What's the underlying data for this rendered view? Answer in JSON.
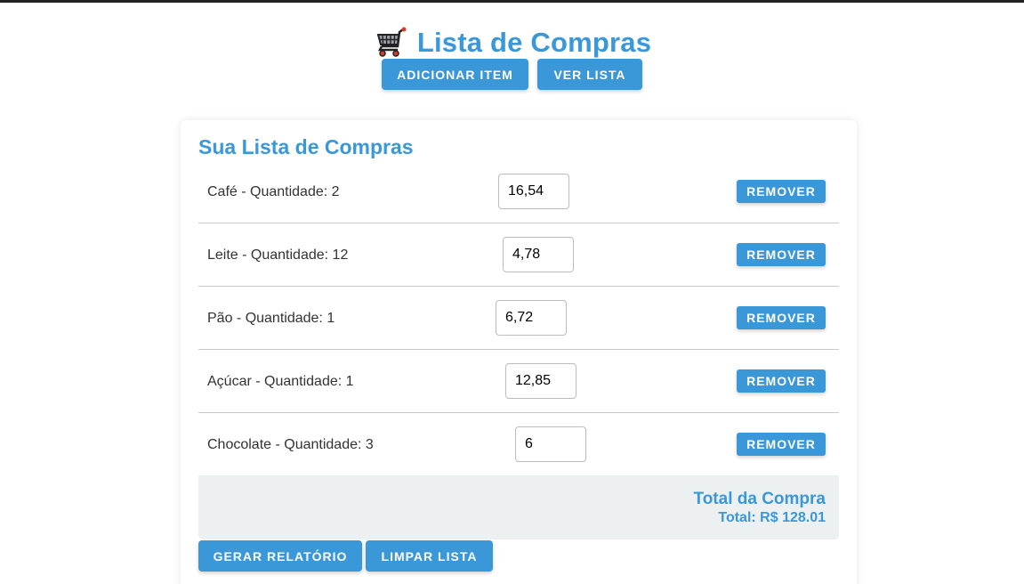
{
  "header": {
    "title": "Lista de Compras",
    "icon": "shopping-cart-icon"
  },
  "nav": {
    "add_item": "ADICIONAR ITEM",
    "view_list": "VER LISTA"
  },
  "list_section": {
    "title": "Sua Lista de Compras",
    "remove_label": "REMOVER",
    "items": [
      {
        "label": "Café - Quantidade: 2",
        "price": "16,54"
      },
      {
        "label": "Leite - Quantidade: 12",
        "price": "4,78"
      },
      {
        "label": "Pão - Quantidade: 1",
        "price": "6,72"
      },
      {
        "label": "Açúcar - Quantidade: 1",
        "price": "12,85"
      },
      {
        "label": "Chocolate - Quantidade: 3",
        "price": "6"
      }
    ]
  },
  "total": {
    "title": "Total da Compra",
    "value": "Total: R$ 128.01"
  },
  "actions": {
    "report": "GERAR RELATÓRIO",
    "clear": "LIMPAR LISTA"
  },
  "colors": {
    "accent": "#3a97d8",
    "total_background": "#ecf0f1"
  }
}
